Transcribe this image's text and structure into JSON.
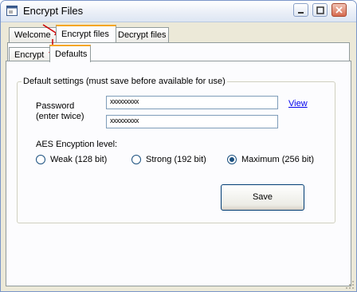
{
  "window": {
    "title": "Encrypt Files"
  },
  "tabs": [
    "Welcome",
    "Encrypt files",
    "Decrypt files"
  ],
  "subtabs": [
    "Encrypt",
    "Defaults"
  ],
  "group": {
    "legend": "Default settings (must save before available for use)"
  },
  "password": {
    "label_line1": "Password",
    "label_line2": "(enter twice)",
    "value1": "xxxxxxxxx",
    "value2": "xxxxxxxxx",
    "view_link": "View"
  },
  "aes": {
    "label": "AES Encyption level:",
    "options": [
      "Weak (128 bit)",
      "Strong (192 bit)",
      "Maximum (256 bit)"
    ],
    "selected": "Maximum (256 bit)"
  },
  "save_label": "Save",
  "colors": {
    "accent_tab": "#f5a623",
    "annotation_arrow": "#cc0000",
    "link": "#0000ee"
  }
}
